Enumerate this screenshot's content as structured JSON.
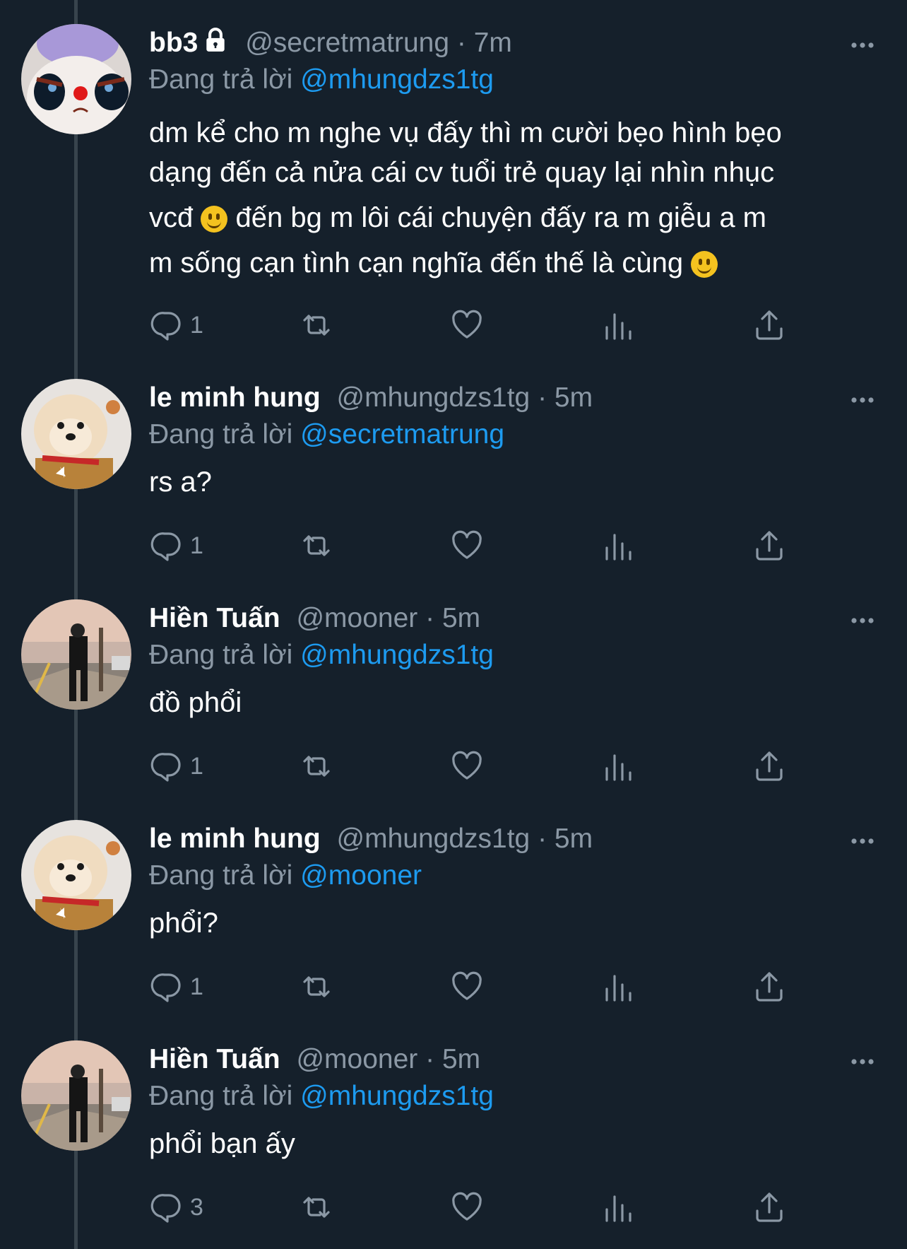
{
  "replying_prefix": "Đang trả lời",
  "tweets": [
    {
      "name": "bb3",
      "handle": "@secretmatrung",
      "time": "7m",
      "reply_to": "@mhungdzs1tg",
      "text_lines": [
        "dm kể cho m nghe vụ đấy thì m cười bẹo hình bẹo",
        "dạng đến cả nửa cái cv tuổi trẻ quay lại nhìn nhục",
        "vcđ",
        "đến bg m lôi cái chuyện đấy ra m giễu a m",
        "m sống cạn tình cạn nghĩa đến thế là cùng"
      ],
      "replies": "1",
      "locked_icon": "lock-icon",
      "emoji": "slightly-smiling-face"
    },
    {
      "name": "le minh hung",
      "handle": "@mhungdzs1tg",
      "time": "5m",
      "reply_to": "@secretmatrung",
      "text": "rs a?",
      "replies": "1"
    },
    {
      "name": "Hiền Tuấn",
      "handle": "@mooner",
      "time": "5m",
      "reply_to": "@mhungdzs1tg",
      "text": "đồ phổi",
      "replies": "1"
    },
    {
      "name": "le minh hung",
      "handle": "@mhungdzs1tg",
      "time": "5m",
      "reply_to": "@mooner",
      "text": "phổi?",
      "replies": "1"
    },
    {
      "name": "Hiền Tuấn",
      "handle": "@mooner",
      "time": "5m",
      "reply_to": "@mhungdzs1tg",
      "text": "phổi bạn ấy",
      "replies": "3"
    }
  ],
  "icons": [
    "reply-icon",
    "retweet-icon",
    "like-icon",
    "views-icon",
    "share-icon",
    "more-icon"
  ],
  "colors": {
    "background": "#15202b",
    "secondary": "#8b98a5",
    "link": "#1d9bf0",
    "thread": "#38444d"
  }
}
